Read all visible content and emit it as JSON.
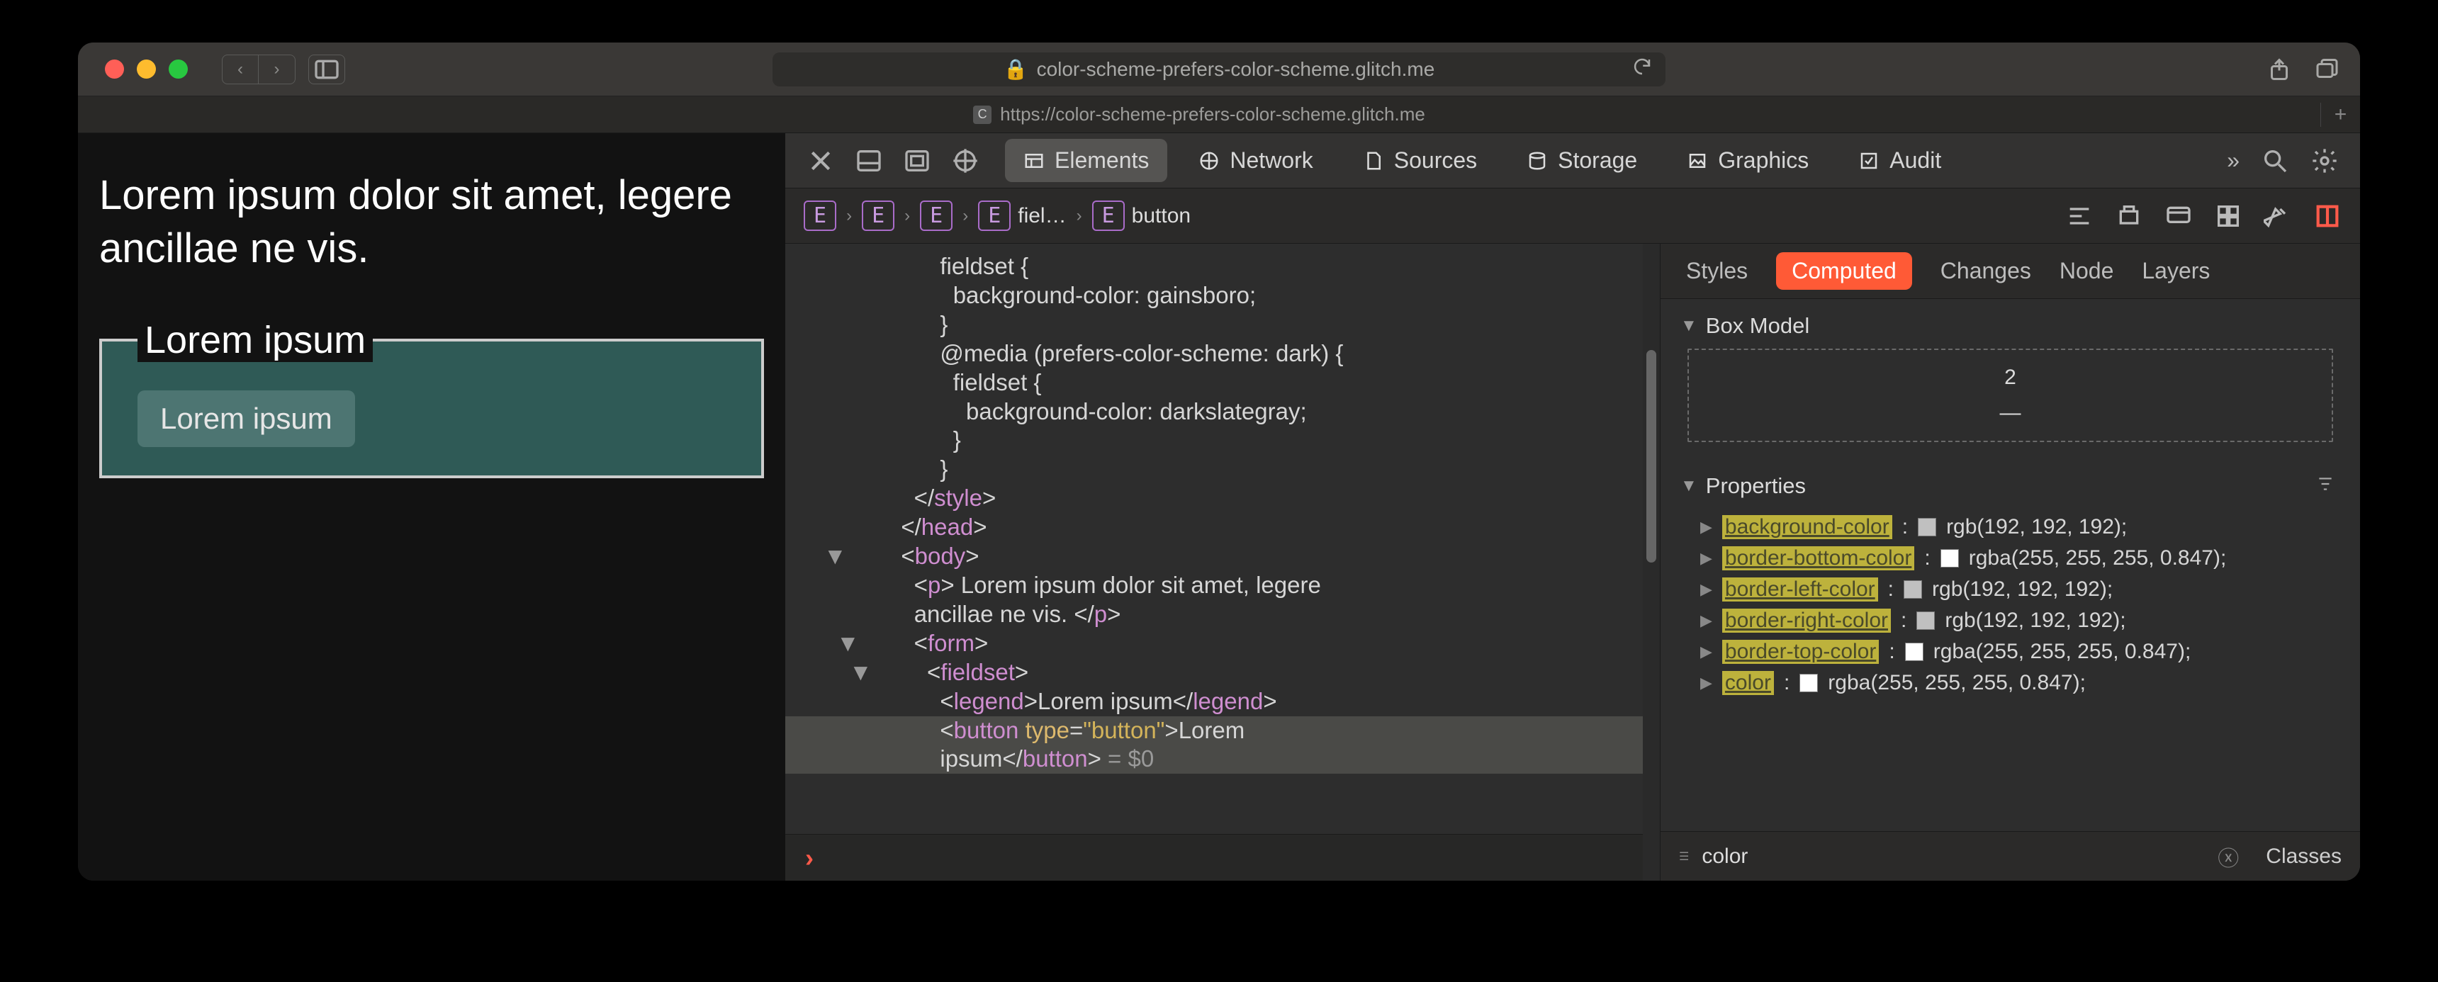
{
  "titlebar": {
    "url_display": "color-scheme-prefers-color-scheme.glitch.me",
    "lock_icon": "lock-icon"
  },
  "tab": {
    "favicon_letter": "C",
    "title": "https://color-scheme-prefers-color-scheme.glitch.me"
  },
  "page_content": {
    "paragraph": "Lorem ipsum dolor sit amet, legere ancillae ne vis.",
    "legend": "Lorem ipsum",
    "button_label": "Lorem ipsum"
  },
  "devtools": {
    "main_tabs": [
      "Elements",
      "Network",
      "Sources",
      "Storage",
      "Graphics",
      "Audit"
    ],
    "active_main_tab": "Elements",
    "breadcrumb": [
      {
        "chip": "E"
      },
      {
        "chip": "E"
      },
      {
        "chip": "E"
      },
      {
        "chip": "E",
        "label": "fiel…"
      },
      {
        "chip": "E",
        "label": "button"
      }
    ],
    "code_lines": [
      {
        "indent": 7,
        "html": "<span class='text'>fieldset {</span>"
      },
      {
        "indent": 8,
        "html": "<span class='text'>background-color: gainsboro;</span>"
      },
      {
        "indent": 7,
        "html": "<span class='text'>}</span>"
      },
      {
        "indent": 7,
        "html": "<span class='text'>@media (prefers-color-scheme: dark) {</span>"
      },
      {
        "indent": 8,
        "html": "<span class='text'>fieldset {</span>"
      },
      {
        "indent": 9,
        "html": "<span class='text'>background-color: darkslategray;</span>"
      },
      {
        "indent": 8,
        "html": "<span class='text'>}</span>"
      },
      {
        "indent": 7,
        "html": "<span class='text'>}</span>"
      },
      {
        "indent": 5,
        "html": "&lt;/<span class='tag-name'>style</span>&gt;"
      },
      {
        "indent": 4,
        "html": "&lt;/<span class='tag-name'>head</span>&gt;"
      },
      {
        "indent": 4,
        "html": "&lt;<span class='tag-name'>body</span>&gt;",
        "caret": "▼"
      },
      {
        "indent": 5,
        "html": "&lt;<span class='tag-name'>p</span>&gt; <span class='text'>Lorem ipsum dolor sit amet, legere</span>"
      },
      {
        "indent": 5,
        "html": "<span class='text'>ancillae ne vis. </span>&lt;/<span class='tag-name'>p</span>&gt;"
      },
      {
        "indent": 5,
        "html": "&lt;<span class='tag-name'>form</span>&gt;",
        "caret": "▼"
      },
      {
        "indent": 6,
        "html": "&lt;<span class='tag-name'>fieldset</span>&gt;",
        "caret": "▼"
      },
      {
        "indent": 7,
        "html": "&lt;<span class='tag-name'>legend</span>&gt;<span class='text'>Lorem ipsum</span>&lt;/<span class='tag-name'>legend</span>&gt;"
      },
      {
        "indent": 7,
        "html": "&lt;<span class='tag-name'>button</span> <span class='attr'>type</span>=<span class='string'>&quot;button&quot;</span>&gt;<span class='text'>Lorem</span>",
        "selected": true
      },
      {
        "indent": 7,
        "html": "<span class='text'>ipsum</span>&lt;/<span class='tag-name'>button</span>&gt; <span style='color:#9a9a9a'>= $0</span>",
        "selected": true
      }
    ],
    "styles_tabs": [
      "Styles",
      "Computed",
      "Changes",
      "Node",
      "Layers"
    ],
    "active_styles_tab": "Computed",
    "box_model": {
      "title": "Box Model",
      "top": "2",
      "mid": "—"
    },
    "properties_title": "Properties",
    "properties": [
      {
        "name": "background-color",
        "swatch": "#c0c0c0",
        "value": "rgb(192, 192, 192)"
      },
      {
        "name": "border-bottom-color",
        "swatch": "#ffffff",
        "value": "rgba(255, 255, 255, 0.847)"
      },
      {
        "name": "border-left-color",
        "swatch": "#c0c0c0",
        "value": "rgb(192, 192, 192)"
      },
      {
        "name": "border-right-color",
        "swatch": "#c0c0c0",
        "value": "rgb(192, 192, 192)"
      },
      {
        "name": "border-top-color",
        "swatch": "#ffffff",
        "value": "rgba(255, 255, 255, 0.847)"
      },
      {
        "name": "color",
        "swatch": "#ffffff",
        "value": "rgba(255, 255, 255, 0.847)"
      }
    ],
    "filter_value": "color",
    "classes_label": "Classes"
  }
}
